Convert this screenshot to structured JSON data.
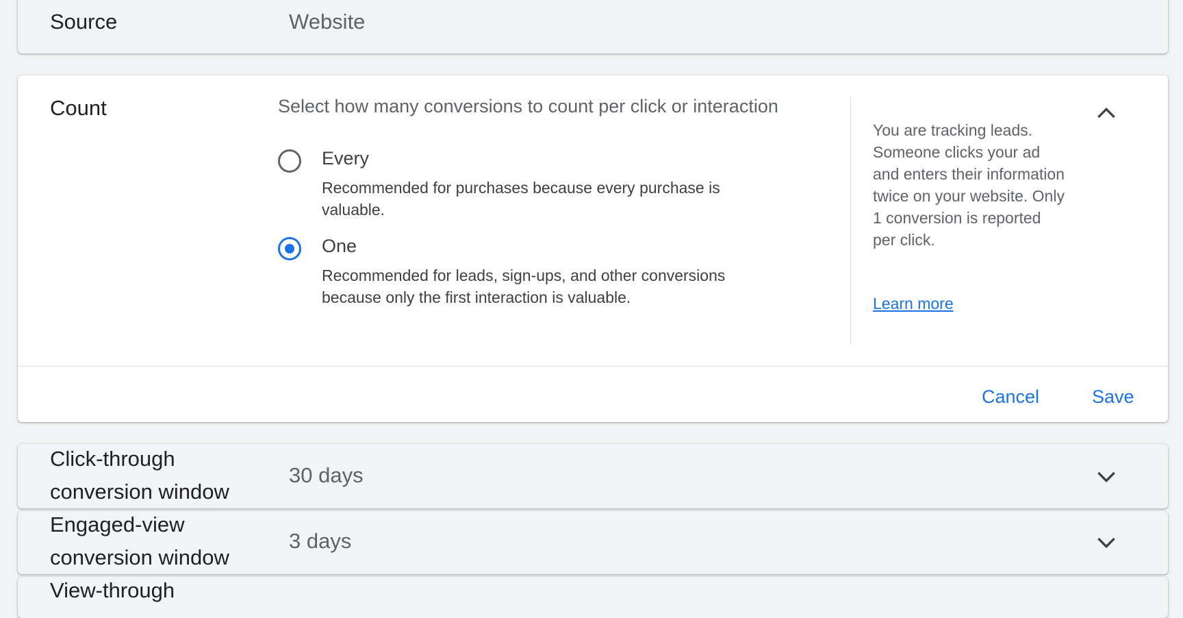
{
  "source": {
    "label": "Source",
    "value": "Website"
  },
  "count": {
    "label": "Count",
    "prompt": "Select how many conversions to count per click or interaction",
    "options": [
      {
        "label": "Every",
        "description": "Recommended for purchases because every purchase is valuable.",
        "selected": false
      },
      {
        "label": "One",
        "description": "Recommended for leads, sign-ups, and other conversions because only the first interaction is valuable.",
        "selected": true
      }
    ],
    "help_text": "You are tracking leads. Someone clicks your ad and enters their information twice on your website. Only 1 conversion is reported per click.",
    "learn_more": "Learn more",
    "cancel_label": "Cancel",
    "save_label": "Save"
  },
  "click_through": {
    "label_line1": "Click-through",
    "label_line2": "conversion window",
    "value": "30 days"
  },
  "engaged_view": {
    "label_line1": "Engaged-view",
    "label_line2": "conversion window",
    "value": "3 days"
  },
  "view_through": {
    "label_line1": "View-through"
  },
  "colors": {
    "accent": "#1a73e8",
    "background": "#f1f3f4",
    "card_expanded": "#ffffff",
    "text_primary": "#202124",
    "text_secondary": "#5f6368"
  },
  "icons": {
    "collapse": "chevron-up-icon",
    "expand": "chevron-down-icon"
  }
}
